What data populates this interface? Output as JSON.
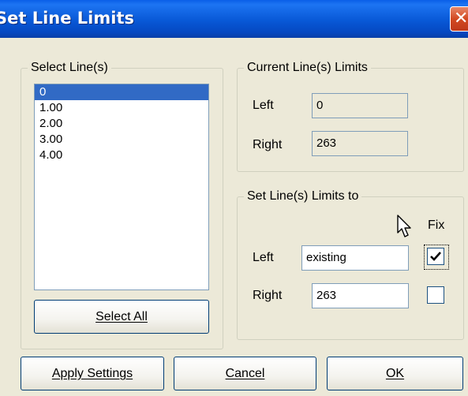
{
  "window": {
    "title": "Set Line Limits",
    "close_symbol": "✕"
  },
  "select_lines": {
    "label": "Select Line(s)",
    "items": [
      "0",
      "1.00",
      "2.00",
      "3.00",
      "4.00"
    ],
    "selected": "0",
    "select_all_label": "Select All"
  },
  "current_limits": {
    "label": "Current Line(s) Limits",
    "left_label": "Left",
    "left_value": "0",
    "right_label": "Right",
    "right_value": "263"
  },
  "set_limits": {
    "label": "Set Line(s) Limits to",
    "fix_label": "Fix",
    "left_label": "Left",
    "left_value": "existing",
    "left_fix_checked": true,
    "right_label": "Right",
    "right_value": "263",
    "right_fix_checked": false
  },
  "buttons": {
    "apply_label": "Apply Settings",
    "cancel_label": "Cancel",
    "ok_label": "OK"
  }
}
